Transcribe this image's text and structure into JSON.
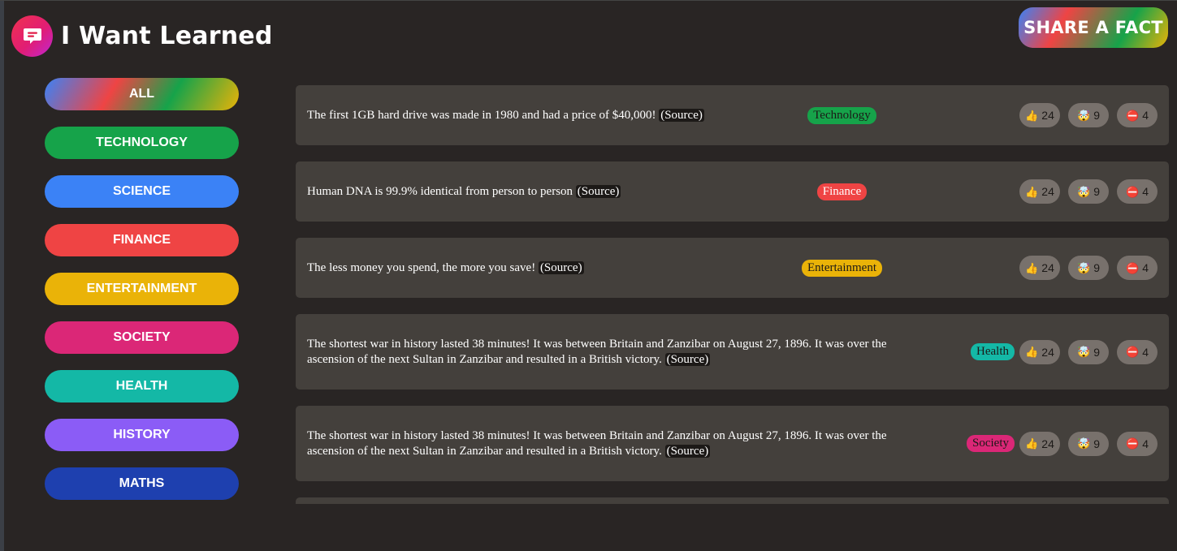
{
  "app": {
    "title": "I Want Learned",
    "share_label": "SHARE A FACT"
  },
  "categories": [
    {
      "label": "ALL",
      "color": "linear-gradient(120deg,#3b82f6 0%,#ef4444 35%,#16a34a 65%,#eab308 100%)"
    },
    {
      "label": "TECHNOLOGY",
      "color": "#16a34a"
    },
    {
      "label": "SCIENCE",
      "color": "#3b82f6"
    },
    {
      "label": "FINANCE",
      "color": "#ef4444"
    },
    {
      "label": "ENTERTAINMENT",
      "color": "#eab308"
    },
    {
      "label": "SOCIETY",
      "color": "#db2777"
    },
    {
      "label": "HEALTH",
      "color": "#14b8a6"
    },
    {
      "label": "HISTORY",
      "color": "#8b5cf6"
    },
    {
      "label": "MATHS",
      "color": "#1e40af"
    }
  ],
  "facts": [
    {
      "text": "The first 1GB hard drive was made in 1980 and had a price of $40,000!",
      "source_label": "(Source)",
      "category": "Technology",
      "color": "#16a34a",
      "interesting": "24",
      "mindblowing": "9",
      "false_votes": "4"
    },
    {
      "text": "Human DNA is 99.9% identical from person to person",
      "source_label": "(Source)",
      "category": "Finance",
      "color": "#ef4444",
      "interesting": "24",
      "mindblowing": "9",
      "false_votes": "4"
    },
    {
      "text": "The less money you spend, the more you save!",
      "source_label": "(Source)",
      "category": "Entertainment",
      "color": "#eab308",
      "interesting": "24",
      "mindblowing": "9",
      "false_votes": "4"
    },
    {
      "text": "The shortest war in history lasted 38 minutes! It was between Britain and Zanzibar on August 27, 1896. It was over the ascension of the next Sultan in Zanzibar and resulted in a British victory.",
      "source_label": "(Source)",
      "category": "Health",
      "color": "#14b8a6",
      "interesting": "24",
      "mindblowing": "9",
      "false_votes": "4"
    },
    {
      "text": "The shortest war in history lasted 38 minutes! It was between Britain and Zanzibar on August 27, 1896. It was over the ascension of the next Sultan in Zanzibar and resulted in a British victory.",
      "source_label": "(Source)",
      "category": "Society",
      "color": "#db2777",
      "interesting": "24",
      "mindblowing": "9",
      "false_votes": "4"
    }
  ],
  "vote_icons": {
    "interesting": "thumbs-up-icon",
    "mindblowing": "mind-blown-icon",
    "false_votes": "no-entry-icon"
  }
}
